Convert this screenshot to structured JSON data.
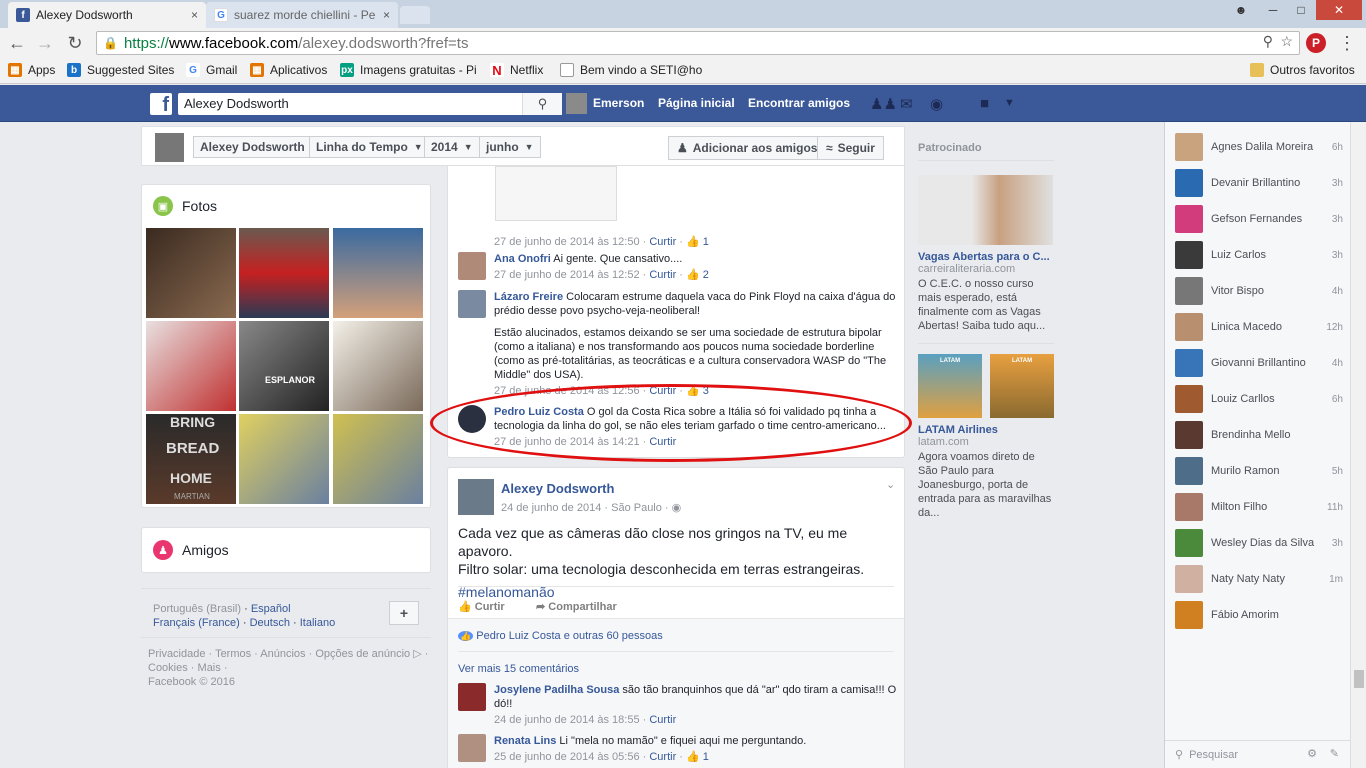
{
  "browser": {
    "tabs": [
      {
        "title": "Alexey Dodsworth",
        "close": "×"
      },
      {
        "title": "suarez morde chiellini - Pe",
        "close": "×"
      }
    ],
    "url": {
      "scheme": "https://",
      "domain": "www.facebook.com",
      "path": "/alexey.dodsworth?fref=ts"
    },
    "bookmarks": [
      "Apps",
      "Suggested Sites",
      "Gmail",
      "Aplicativos",
      "Imagens gratuitas - Pi",
      "Netflix",
      "Bem vindo a SETI@ho"
    ],
    "other_bookmarks": "Outros favoritos"
  },
  "fb": {
    "logo": "f",
    "search_value": "Alexey Dodsworth",
    "user": "Emerson",
    "nav": [
      "Página inicial",
      "Encontrar amigos"
    ],
    "colors": {
      "brand": "#3b5998",
      "link": "#365899",
      "meta": "#90949c"
    }
  },
  "timeline": {
    "name": "Alexey Dodsworth",
    "section": "Linha do Tempo",
    "year": "2014",
    "month": "junho",
    "add_friend": "Adicionar aos amigos",
    "follow": "Seguir"
  },
  "left": {
    "photos_title": "Fotos",
    "photo_texts": [
      "BRING",
      "BREAD",
      "HOME",
      "MARTIAN",
      "ESPLANOR"
    ],
    "friends_title": "Amigos",
    "languages": [
      "Português (Brasil)",
      "Español",
      "Français (France)",
      "Deutsch",
      "Italiano"
    ],
    "footer": [
      "Privacidade",
      "Termos",
      "Anúncios",
      "Opções de anúncio",
      "Cookies",
      "Mais",
      "Facebook © 2016"
    ]
  },
  "comments": [
    {
      "date": "27 de junho de 2014 às 12:50",
      "action": "Curtir",
      "likes": "1"
    },
    {
      "name": "Ana Onofri",
      "text": "Ai gente. Que cansativo....",
      "date": "27 de junho de 2014 às 12:52",
      "action": "Curtir",
      "likes": "2"
    },
    {
      "name": "Lázaro Freire",
      "text": "Colocaram estrume daquela vaca do Pink Floyd na caixa d'água do prédio desse povo psycho-veja-neoliberal!",
      "text2": "Estão alucinados, estamos deixando se ser uma sociedade de estrutura bipolar (como a italiana) e nos transformando aos poucos numa sociedade borderline (como as pré-totalitárias, as teocráticas e a cultura conservadora WASP do \"The Middle\" dos USA).",
      "date": "27 de junho de 2014 às 12:56",
      "action": "Curtir",
      "likes": "3"
    },
    {
      "name": "Pedro Luiz Costa",
      "text": "O gol da Costa Rica sobre a Itália só foi validado pq tinha a tecnologia da linha do gol, se não eles teriam garfado o time centro-americano...",
      "date": "27 de junho de 2014 às 14:21",
      "action": "Curtir"
    }
  ],
  "post": {
    "author": "Alexey Dodsworth",
    "date": "24 de junho de 2014",
    "place": "São Paulo",
    "text1": "Cada vez que as câmeras dão close nos gringos na TV, eu me apavoro.",
    "text2": "Filtro solar: uma tecnologia desconhecida em terras estrangeiras.",
    "hashtag": "#melanomanão",
    "like": "Curtir",
    "share": "Compartilhar",
    "likers": "Pedro Luiz Costa e outras 60 pessoas",
    "more_comments": "Ver mais 15 comentários",
    "comments": [
      {
        "name": "Josylene Padilha Sousa",
        "text": "são tão branquinhos que dá \"ar\" qdo tiram a camisa!!! O dó!!",
        "date": "24 de junho de 2014 às 18:55",
        "action": "Curtir"
      },
      {
        "name": "Renata Lins",
        "text": "Li \"mela no mamão\" e fiquei aqui me perguntando.",
        "date": "25 de junho de 2014 às 05:56",
        "action": "Curtir",
        "likes": "1"
      }
    ]
  },
  "sponsored": {
    "header": "Patrocinado",
    "ads": [
      {
        "title": "Vagas Abertas para o C...",
        "url": "carreiraliteraria.com",
        "body": "O C.E.C. o nosso curso mais esperado, está finalmente com as Vagas Abertas! Saiba tudo aqu..."
      },
      {
        "title": "LATAM Airlines",
        "url": "latam.com",
        "body": "Agora voamos direto de São Paulo para Joanesburgo, porta de entrada para as maravilhas da..."
      }
    ],
    "latam_logo": "LATAM"
  },
  "chat": {
    "friends": [
      {
        "name": "Agnes Dalila Moreira",
        "ago": "6h",
        "color": "#c9a27e"
      },
      {
        "name": "Devanir Brillantino",
        "ago": "3h",
        "color": "#2a6ab0"
      },
      {
        "name": "Gefson Fernandes",
        "ago": "3h",
        "color": "#d23c7c"
      },
      {
        "name": "Luiz Carlos",
        "ago": "3h",
        "color": "#3a3a3a"
      },
      {
        "name": "Vitor Bispo",
        "ago": "4h",
        "color": "#777777"
      },
      {
        "name": "Linica Macedo",
        "ago": "12h",
        "color": "#b89070"
      },
      {
        "name": "Giovanni Brillantino",
        "ago": "4h",
        "color": "#3875b8"
      },
      {
        "name": "Louiz Carllos",
        "ago": "6h",
        "color": "#a05a30"
      },
      {
        "name": "Brendinha Mello",
        "ago": "",
        "color": "#5a3a30"
      },
      {
        "name": "Murilo Ramon",
        "ago": "5h",
        "color": "#4d6d88"
      },
      {
        "name": "Milton Filho",
        "ago": "11h",
        "color": "#a87868"
      },
      {
        "name": "Wesley Dias da Silva",
        "ago": "3h",
        "color": "#4a8a3a"
      },
      {
        "name": "Naty Naty Naty",
        "ago": "1m",
        "color": "#d0b0a0"
      },
      {
        "name": "Fábio Amorim",
        "ago": "",
        "color": "#d08020"
      }
    ],
    "search_placeholder": "Pesquisar"
  }
}
